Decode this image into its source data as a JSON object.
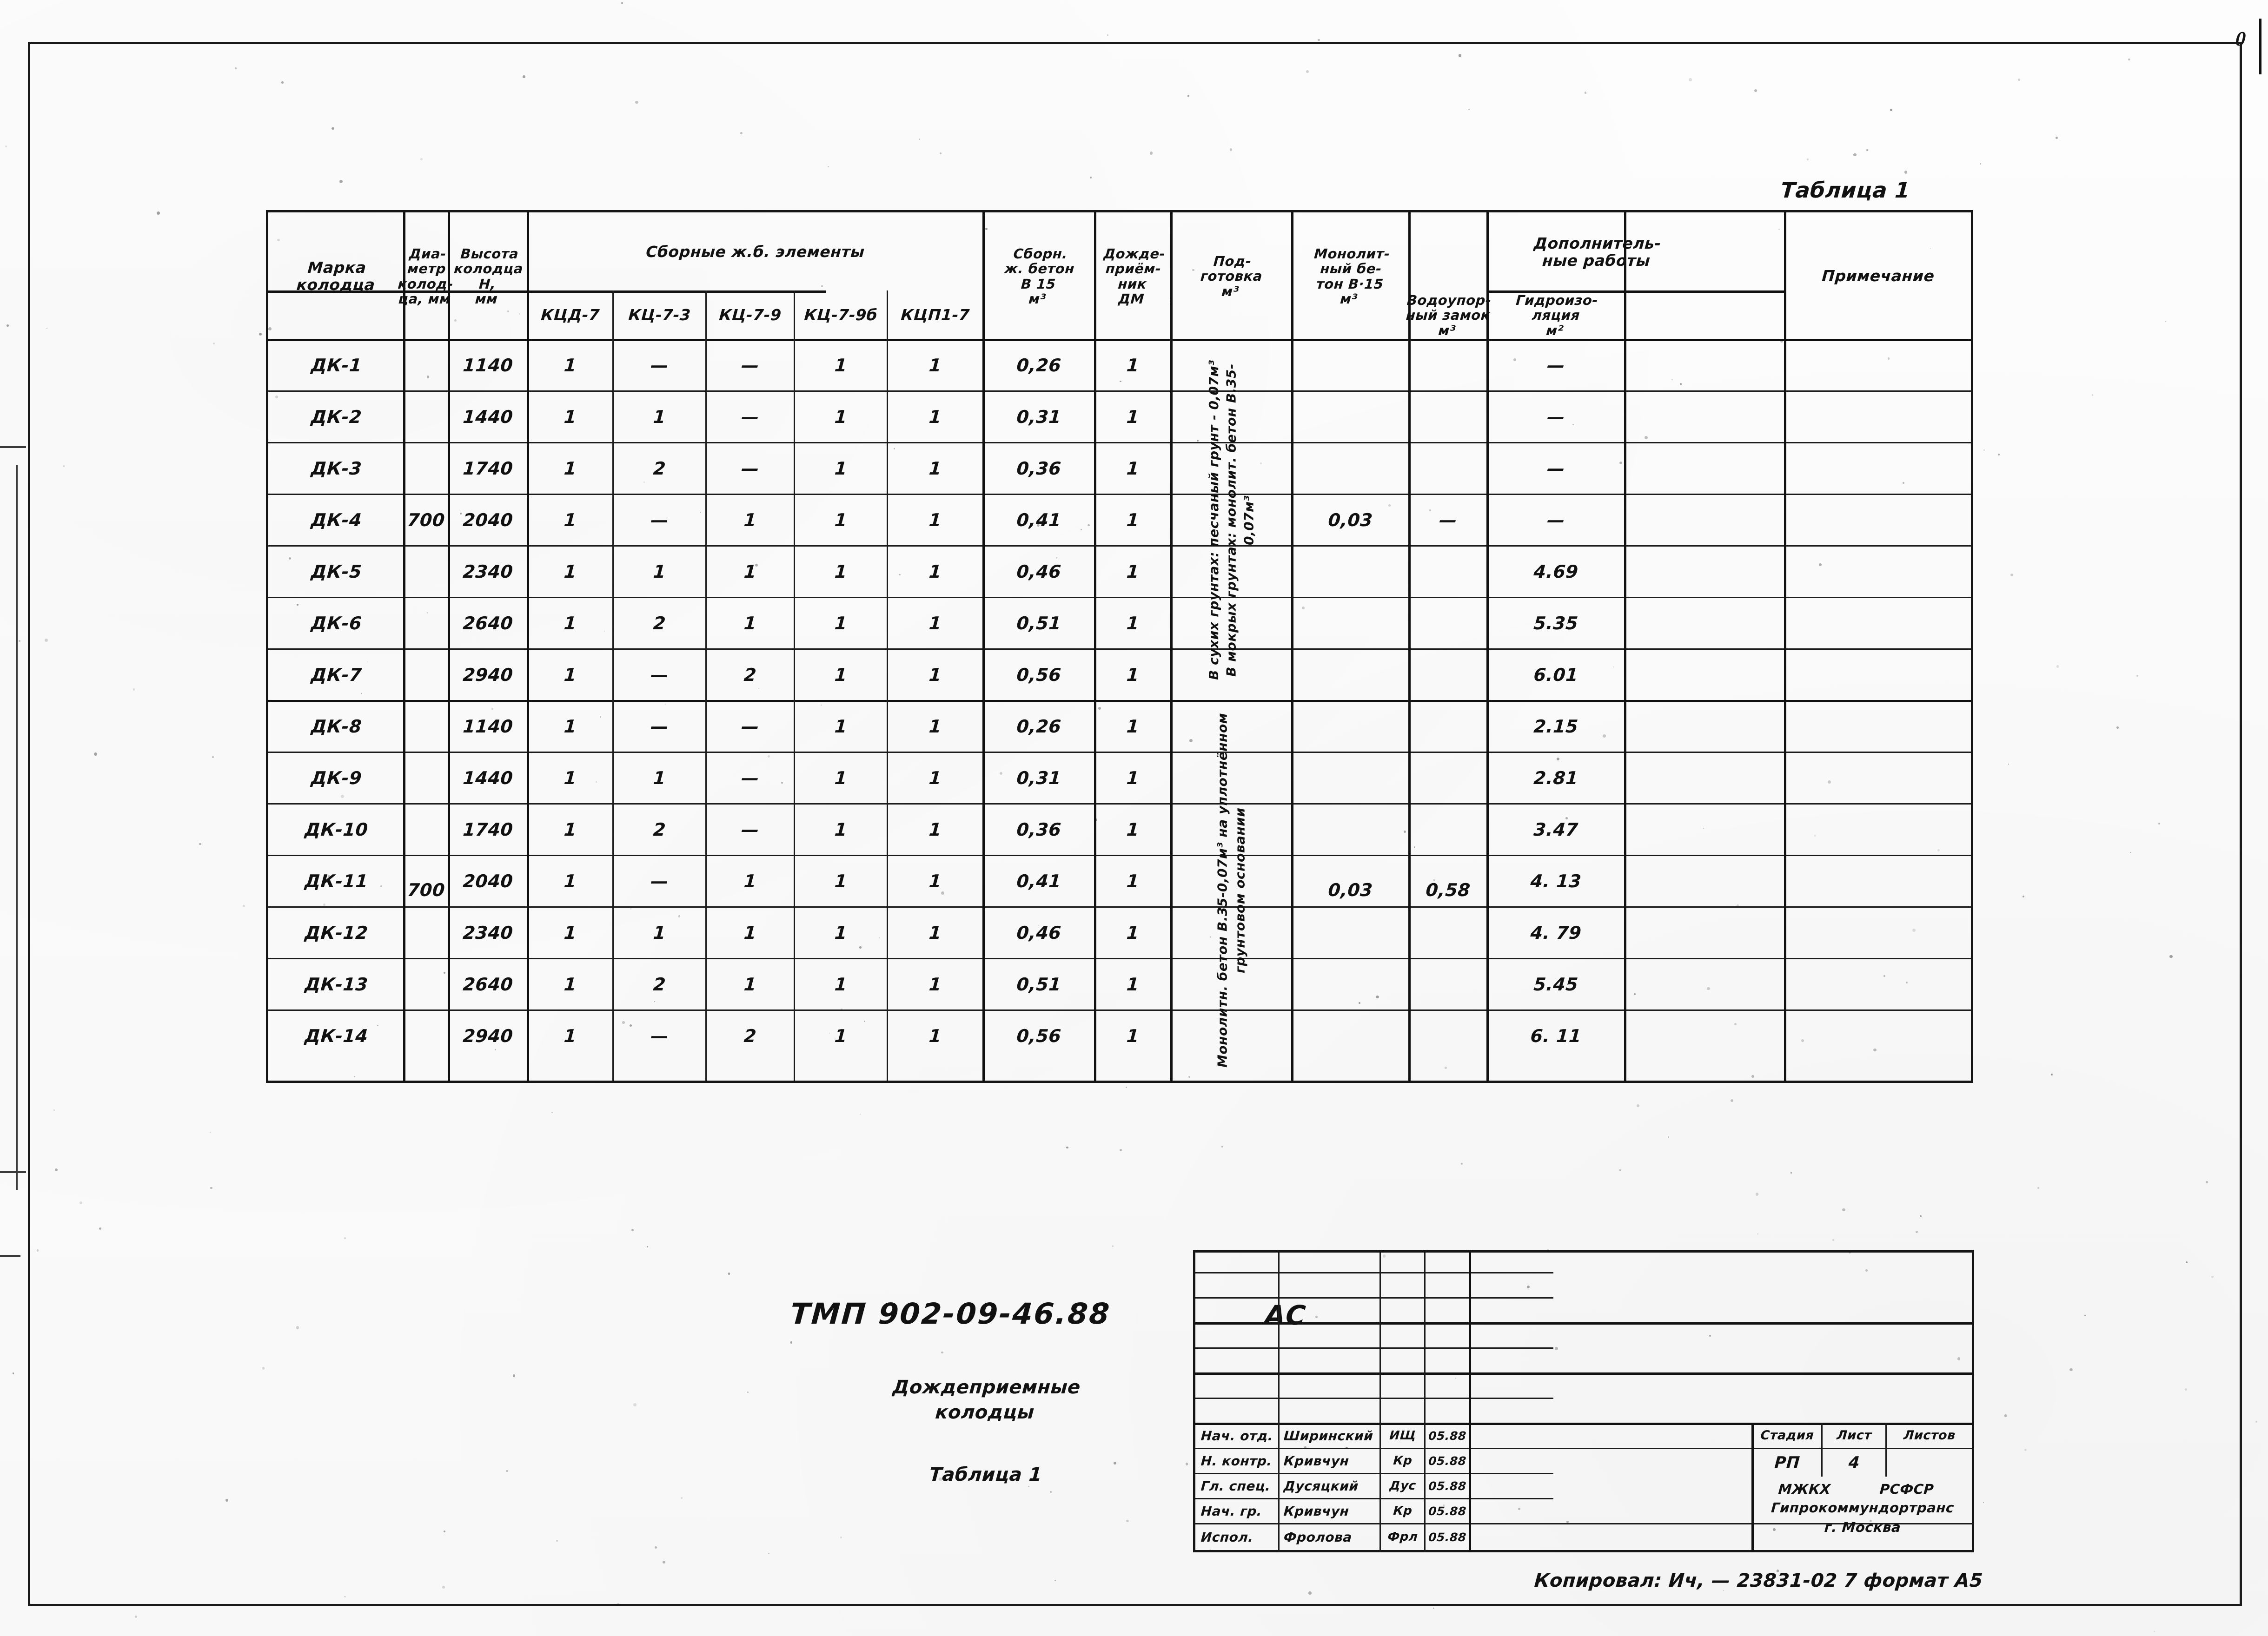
{
  "sheet": {
    "corner_mark": "0",
    "table_caption": "Таблица 1"
  },
  "table": {
    "headers": {
      "mark": "Марка\nколодца",
      "diameter": "Диа-\nметр\nколод-\nца, мм",
      "height": "Высота\nколодца\nН,\nмм",
      "precast_group": "Сборные  ж.б.  элементы",
      "precast_cols": [
        "КЦД-7",
        "КЦ-7-3",
        "КЦ-7-9",
        "КЦ-7-9б",
        "КЦП1-7"
      ],
      "sborn_concrete": "Сборн.\nж. бетон\nВ 15\nм³",
      "rain_inlet": "Дожде-\nприём-\nник\nДМ",
      "preparation": "Под-\nготовка\nм³",
      "monolithic": "Монолит-\nный бе-\nтон В·15\nм³",
      "additional_group": "Дополнитель-\nные работы",
      "water_lock": "Водоупор-\nный замок\nм³",
      "waterproofing": "Гидроизо-\nляция\nм²",
      "note": "Примечание"
    },
    "group_notes": {
      "group1_preparation": "В сухих грунтах: песчаный грунт - 0,07м³\nВ мокрых грунтах: монолит. бетон В.35-0,07м³",
      "group2_preparation": "Монолитн. бетон В.35-0,07м³ на уплотнённом грунтовом основании"
    },
    "group1": {
      "diameter": "700",
      "monolithic": "0,03",
      "water_lock": "—",
      "rows": [
        {
          "mark": "ДК-1",
          "height": "1140",
          "kcd7": "1",
          "kc73": "—",
          "kc79": "—",
          "kc79b": "1",
          "kcp17": "1",
          "sborn": "0,26",
          "dm": "1",
          "hydro": "—"
        },
        {
          "mark": "ДК-2",
          "height": "1440",
          "kcd7": "1",
          "kc73": "1",
          "kc79": "—",
          "kc79b": "1",
          "kcp17": "1",
          "sborn": "0,31",
          "dm": "1",
          "hydro": "—"
        },
        {
          "mark": "ДК-3",
          "height": "1740",
          "kcd7": "1",
          "kc73": "2",
          "kc79": "—",
          "kc79b": "1",
          "kcp17": "1",
          "sborn": "0,36",
          "dm": "1",
          "hydro": "—"
        },
        {
          "mark": "ДК-4",
          "height": "2040",
          "kcd7": "1",
          "kc73": "—",
          "kc79": "1",
          "kc79b": "1",
          "kcp17": "1",
          "sborn": "0,41",
          "dm": "1",
          "hydro": "—"
        },
        {
          "mark": "ДК-5",
          "height": "2340",
          "kcd7": "1",
          "kc73": "1",
          "kc79": "1",
          "kc79b": "1",
          "kcp17": "1",
          "sborn": "0,46",
          "dm": "1",
          "hydro": "4.69"
        },
        {
          "mark": "ДК-6",
          "height": "2640",
          "kcd7": "1",
          "kc73": "2",
          "kc79": "1",
          "kc79b": "1",
          "kcp17": "1",
          "sborn": "0,51",
          "dm": "1",
          "hydro": "5.35"
        },
        {
          "mark": "ДК-7",
          "height": "2940",
          "kcd7": "1",
          "kc73": "—",
          "kc79": "2",
          "kc79b": "1",
          "kcp17": "1",
          "sborn": "0,56",
          "dm": "1",
          "hydro": "6.01"
        }
      ]
    },
    "group2": {
      "diameter": "700",
      "monolithic": "0,03",
      "water_lock": "0,58",
      "rows": [
        {
          "mark": "ДК-8",
          "height": "1140",
          "kcd7": "1",
          "kc73": "—",
          "kc79": "—",
          "kc79b": "1",
          "kcp17": "1",
          "sborn": "0,26",
          "dm": "1",
          "hydro": "2.15"
        },
        {
          "mark": "ДК-9",
          "height": "1440",
          "kcd7": "1",
          "kc73": "1",
          "kc79": "—",
          "kc79b": "1",
          "kcp17": "1",
          "sborn": "0,31",
          "dm": "1",
          "hydro": "2.81"
        },
        {
          "mark": "ДК-10",
          "height": "1740",
          "kcd7": "1",
          "kc73": "2",
          "kc79": "—",
          "kc79b": "1",
          "kcp17": "1",
          "sborn": "0,36",
          "dm": "1",
          "hydro": "3.47"
        },
        {
          "mark": "ДК-11",
          "height": "2040",
          "kcd7": "1",
          "kc73": "—",
          "kc79": "1",
          "kc79b": "1",
          "kcp17": "1",
          "sborn": "0,41",
          "dm": "1",
          "hydro": "4. 13"
        },
        {
          "mark": "ДК-12",
          "height": "2340",
          "kcd7": "1",
          "kc73": "1",
          "kc79": "1",
          "kc79b": "1",
          "kcp17": "1",
          "sborn": "0,46",
          "dm": "1",
          "hydro": "4. 79"
        },
        {
          "mark": "ДК-13",
          "height": "2640",
          "kcd7": "1",
          "kc73": "2",
          "kc79": "1",
          "kc79b": "1",
          "kcp17": "1",
          "sborn": "0,51",
          "dm": "1",
          "hydro": "5.45"
        },
        {
          "mark": "ДК-14",
          "height": "2940",
          "kcd7": "1",
          "kc73": "—",
          "kc79": "2",
          "kc79b": "1",
          "kcp17": "1",
          "sborn": "0,56",
          "dm": "1",
          "hydro": "6. 11"
        }
      ]
    }
  },
  "title_block": {
    "designation": "ТМП  902-09-46.88",
    "mark_ac": "АС",
    "object_name": "Дождеприемные\nколодцы",
    "sheet_subtitle": "Таблица 1",
    "stage_header": "Стадия",
    "list_header": "Лист",
    "lists_header": "Листов",
    "stage_value": "РП",
    "list_value": "4",
    "organization": {
      "line1_left": "МЖКХ",
      "line1_right": "РСФСР",
      "line2": "Гипрокоммундортранс",
      "line3": "г. Москва"
    },
    "signature_rows": [
      {
        "role": "Нач. отд.",
        "name": "Ширинский",
        "sign": "ИЩ",
        "date": "05.88"
      },
      {
        "role": "Н. контр.",
        "name": "Кривчун",
        "sign": "Кр",
        "date": "05.88"
      },
      {
        "role": "Гл. спец.",
        "name": "Дусяцкий",
        "sign": "Дус",
        "date": "05.88"
      },
      {
        "role": "Нач. гр.",
        "name": "Кривчун",
        "sign": "Кр",
        "date": "05.88"
      },
      {
        "role": "Испол.",
        "name": "Фролова",
        "sign": "Фрл",
        "date": "05.88"
      }
    ],
    "copy_line": "Копировал: Ич, —  23831-02  7   формат А5"
  }
}
